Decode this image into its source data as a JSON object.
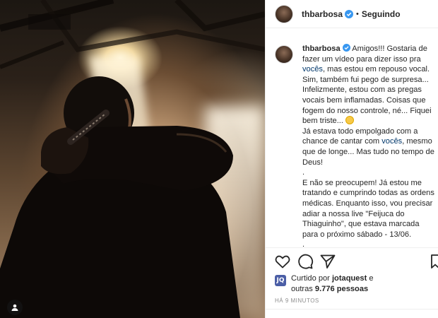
{
  "post": {
    "username": "thbarbosa",
    "follow_status": "Seguindo",
    "separator": "•"
  },
  "caption": {
    "username": "thbarbosa",
    "p1_a": "Amigos!!! Gostaria de fazer um vídeo para dizer isso pra ",
    "p1_mention": "vocês",
    "p1_b": ", mas estou em repouso vocal. Sim, também fui pego de surpresa... Infelizmente, estou com as pregas vocais bem inflamadas. Coisas que fogem do nosso controle, né... Fiquei bem triste... ",
    "p2_a": "Já estava todo empolgado com a chance de cantar com ",
    "p2_mention": "vocês",
    "p2_b": ", mesmo que de longe... Mas tudo no tempo de Deus!",
    "p3": ".",
    "p4": "E não se preocupem! Já estou me tratando e cumprindo todas as ordens médicas. Enquanto isso, vou precisar adiar a nossa live \"Feijuca do Thiaguinho\", que estava marcada para o próximo sábado - 13/06.",
    "p5": "."
  },
  "actions": {
    "like_icon": "heart-icon",
    "comment_icon": "comment-icon",
    "share_icon": "share-icon",
    "save_icon": "bookmark-icon"
  },
  "likes": {
    "prefix": "Curtido por ",
    "user": "jotaquest",
    "middle": " e",
    "line2_a": "outras ",
    "count": "9.776 pessoas",
    "thumb_label": "JQ"
  },
  "timestamp": "HÁ 9 MINUTOS",
  "colors": {
    "verified": "#3897f0",
    "text": "#262626",
    "muted": "#8e8e8e"
  }
}
